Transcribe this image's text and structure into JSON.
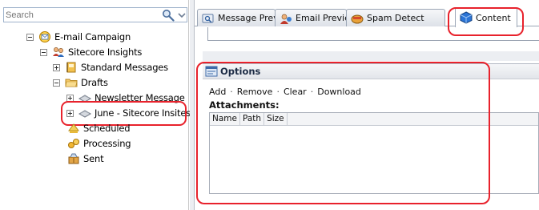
{
  "search": {
    "placeholder": "Search",
    "value": ""
  },
  "tree": {
    "items": [
      {
        "label": "E-mail Campaign",
        "icon": "email-campaign-icon",
        "expander": "minus"
      },
      {
        "label": "Sitecore Insights",
        "icon": "users-icon",
        "expander": "minus"
      },
      {
        "label": "Standard Messages",
        "icon": "notebook-icon",
        "expander": "plus"
      },
      {
        "label": "Drafts",
        "icon": "folder-icon",
        "expander": "minus"
      },
      {
        "label": "Newsletter Message",
        "icon": "message-icon",
        "expander": "plus"
      },
      {
        "label": "June - Sitecore Insites",
        "icon": "message-icon",
        "expander": "plus"
      },
      {
        "label": "Scheduled",
        "icon": "scheduled-icon",
        "expander": "none"
      },
      {
        "label": "Processing",
        "icon": "processing-icon",
        "expander": "none"
      },
      {
        "label": "Sent",
        "icon": "sent-icon",
        "expander": "none"
      }
    ]
  },
  "tabs": [
    {
      "label": "Message Preview",
      "icon": "message-preview-icon"
    },
    {
      "label": "Email Preview",
      "icon": "email-preview-icon"
    },
    {
      "label": "Spam Detect",
      "icon": "spam-detect-icon"
    },
    {
      "label": "Content",
      "icon": "content-cube-icon",
      "active": true
    }
  ],
  "options": {
    "title": "Options",
    "actions": [
      "Add",
      "Remove",
      "Clear",
      "Download"
    ],
    "separator": "·",
    "attachments_label": "Attachments:",
    "columns": [
      "Name",
      "Path",
      "Size"
    ]
  },
  "colors": {
    "highlight": "#e8222c",
    "accent": "#1b62c4"
  }
}
